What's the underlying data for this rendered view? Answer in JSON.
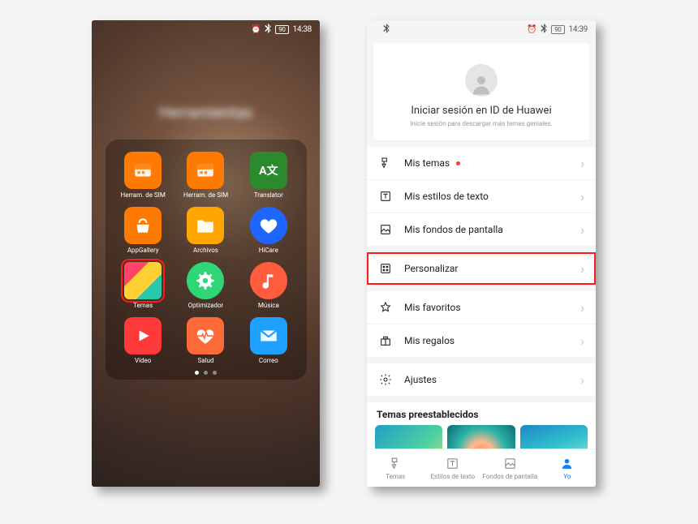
{
  "phoneA": {
    "status": {
      "time": "14:38",
      "battery": "90"
    },
    "folder_title": "Herramientas",
    "apps": [
      {
        "id": "herram-sim-1",
        "label": "Herram. de SIM"
      },
      {
        "id": "herram-sim-2",
        "label": "Herram. de SIM"
      },
      {
        "id": "translator",
        "label": "Translator"
      },
      {
        "id": "appgallery",
        "label": "AppGallery"
      },
      {
        "id": "archivos",
        "label": "Archivos"
      },
      {
        "id": "hicare",
        "label": "HiCare"
      },
      {
        "id": "temas",
        "label": "Temas",
        "highlighted": true
      },
      {
        "id": "optimizador",
        "label": "Optimizador"
      },
      {
        "id": "musica",
        "label": "Música"
      },
      {
        "id": "video",
        "label": "Vídeo"
      },
      {
        "id": "salud",
        "label": "Salud"
      },
      {
        "id": "correo",
        "label": "Correo"
      }
    ],
    "page_dots": {
      "count": 3,
      "active_index": 0
    }
  },
  "phoneB": {
    "status": {
      "time": "14:39",
      "battery": "90"
    },
    "login": {
      "title": "Iniciar sesión en ID de Huawei",
      "sub": "Inicie sesión para descargar más temas geniales."
    },
    "menu_groups": [
      [
        {
          "id": "mis-temas",
          "label": "Mis temas",
          "badge": true
        },
        {
          "id": "mis-estilos",
          "label": "Mis estilos de texto"
        },
        {
          "id": "mis-fondos",
          "label": "Mis fondos de pantalla"
        }
      ],
      [
        {
          "id": "personalizar",
          "label": "Personalizar",
          "highlighted": true
        }
      ],
      [
        {
          "id": "favoritos",
          "label": "Mis favoritos"
        },
        {
          "id": "regalos",
          "label": "Mis regalos"
        }
      ],
      [
        {
          "id": "ajustes",
          "label": "Ajustes"
        }
      ]
    ],
    "preset_title": "Temas preestablecidos",
    "tabs": [
      {
        "id": "temas",
        "label": "Temas"
      },
      {
        "id": "estilos",
        "label": "Estilos de texto"
      },
      {
        "id": "fondos",
        "label": "Fondos de pantalla"
      },
      {
        "id": "yo",
        "label": "Yo",
        "active": true
      }
    ]
  }
}
